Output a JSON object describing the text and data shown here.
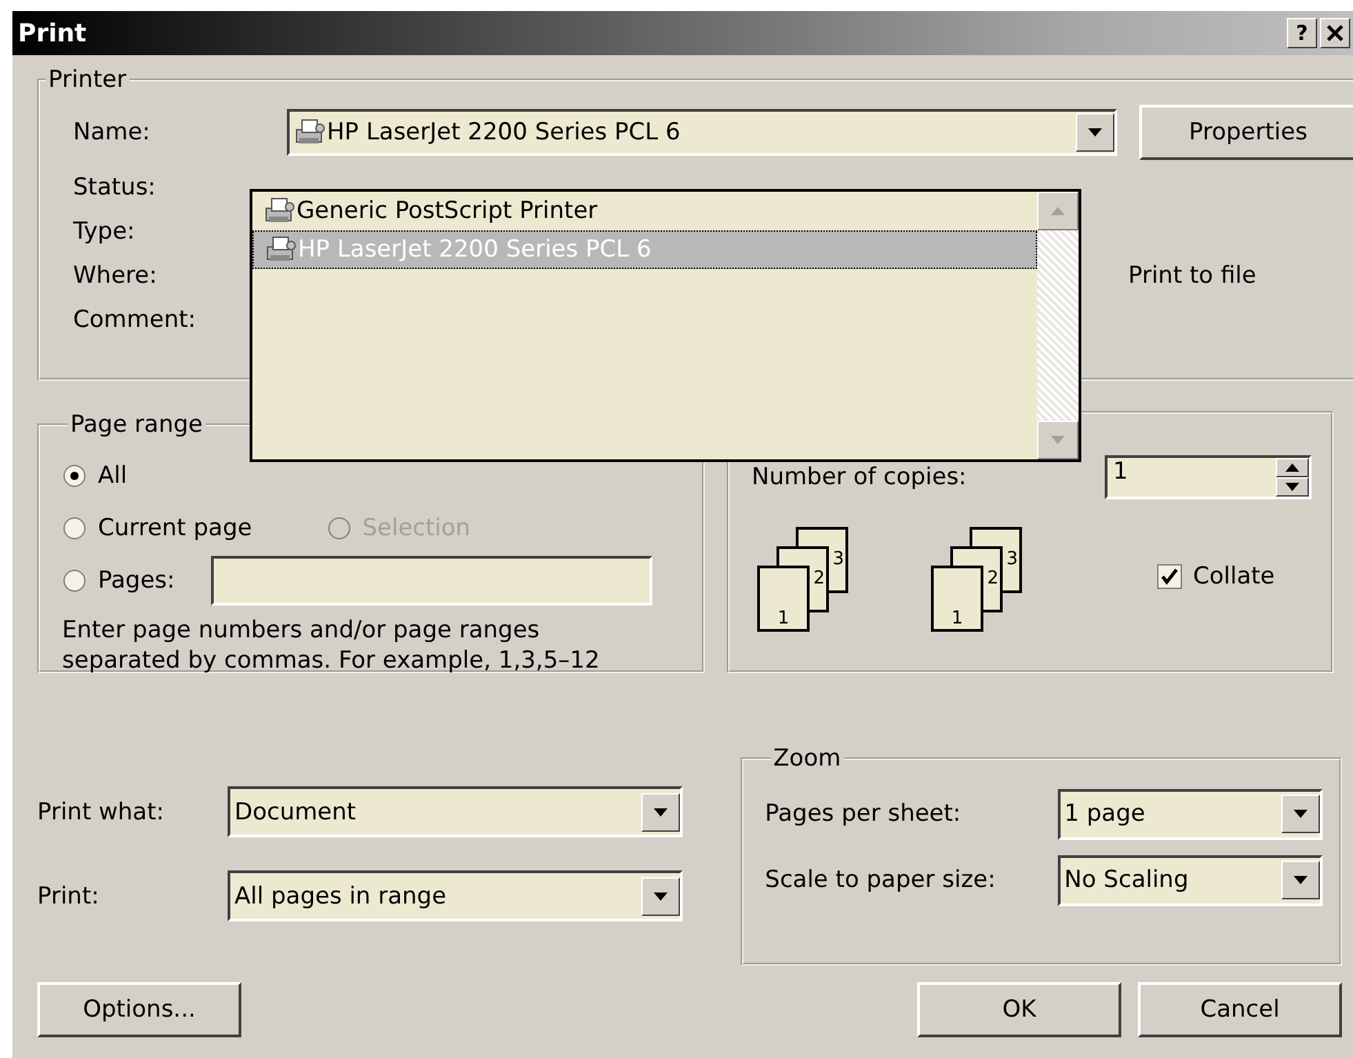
{
  "window": {
    "title": "Print",
    "help_button": "?"
  },
  "printer": {
    "legend": "Printer",
    "name_label": "Name:",
    "name_value": "HP LaserJet 2200 Series PCL 6",
    "properties_button": "Properties",
    "info_labels": [
      "Status:",
      "Type:",
      "Where:",
      "Comment:"
    ],
    "print_to_file": "Print to file"
  },
  "printer_list": {
    "items": [
      {
        "label": "Generic PostScript Printer",
        "selected": false
      },
      {
        "label": "HP LaserJet 2200 Series PCL 6",
        "selected": true
      }
    ]
  },
  "page_range": {
    "legend": "Page range",
    "options": [
      {
        "label": "All",
        "selected": true,
        "disabled": false
      },
      {
        "label": "Current page",
        "selected": false,
        "disabled": false
      },
      {
        "label": "Selection",
        "selected": false,
        "disabled": true
      },
      {
        "label": "Pages:",
        "selected": false,
        "disabled": false
      }
    ],
    "hint": "Enter page numbers and/or page ranges separated by commas.  For example, 1,3,5–12"
  },
  "copies": {
    "label": "Number of copies:",
    "value": "1",
    "page_stacks": [
      {
        "pages": [
          "1",
          "2",
          "3"
        ]
      },
      {
        "pages": [
          "1",
          "2",
          "3"
        ]
      }
    ],
    "collate": {
      "label": "Collate",
      "checked": true
    }
  },
  "print_what": {
    "label": "Print what:",
    "value": "Document"
  },
  "print": {
    "label": "Print:",
    "value": "All pages in range"
  },
  "zoom": {
    "legend": "Zoom",
    "rows": [
      {
        "label": "Pages per sheet:",
        "value": "1 page"
      },
      {
        "label": "Scale to paper size:",
        "value": "No Scaling"
      }
    ]
  },
  "buttons": {
    "options": "Options...",
    "ok": "OK",
    "cancel": "Cancel"
  }
}
